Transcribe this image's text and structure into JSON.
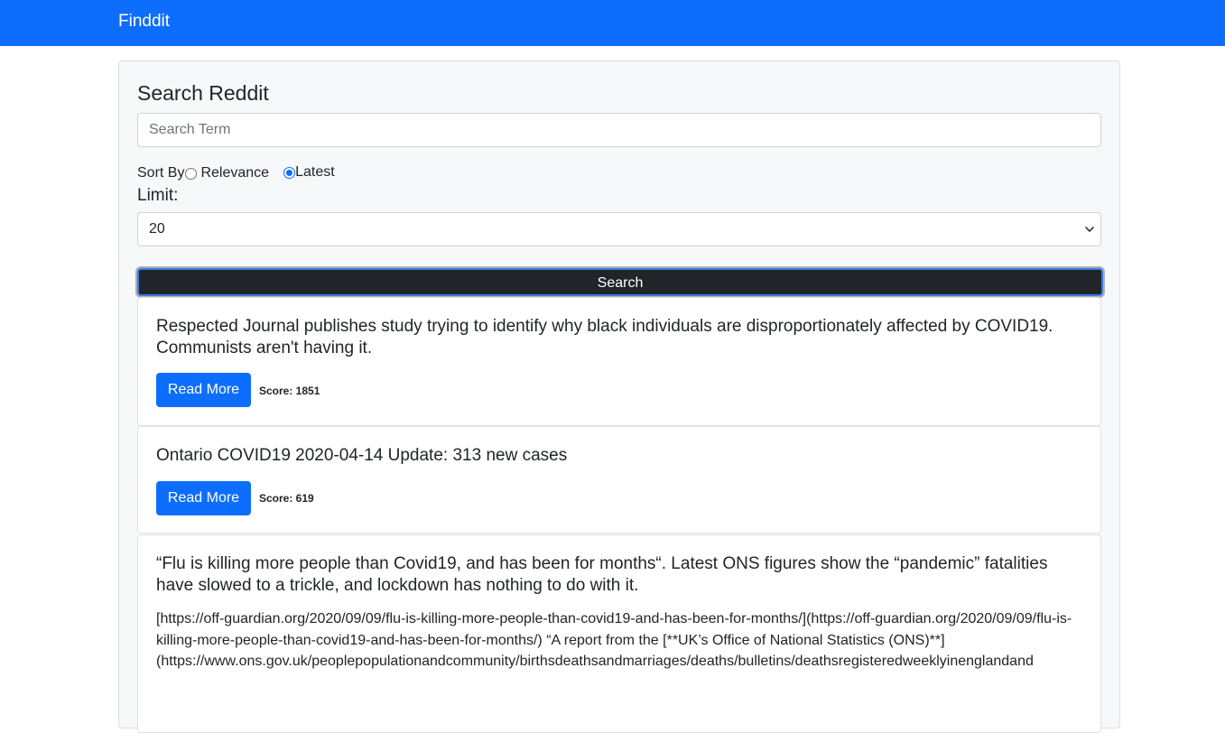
{
  "navbar": {
    "brand": "Finddit"
  },
  "search": {
    "title": "Search Reddit",
    "placeholder": "Search Term",
    "sort_label": "Sort By",
    "sort_options": [
      {
        "label": "Relevance",
        "checked": false
      },
      {
        "label": "Latest",
        "checked": true
      }
    ],
    "limit_label": "Limit:",
    "limit_value": "20",
    "button_label": "Search"
  },
  "results": [
    {
      "title": "Respected Journal publishes study trying to identify why black individuals are disproportionately affected by COVID19. Communists aren't having it.",
      "button": "Read More",
      "score": "Score: 1851"
    },
    {
      "title": "Ontario COVID19 2020-04-14 Update: 313 new cases",
      "button": "Read More",
      "score": "Score: 619"
    },
    {
      "title": "“Flu is killing more people than Covid19, and has been for months“. Latest ONS figures show the “pandemic” fatalities have slowed to a trickle, and lockdown has nothing to do with it.",
      "text": "[https://off-guardian.org/2020/09/09/flu-is-killing-more-people-than-covid19-and-has-been-for-months/](https://off-guardian.org/2020/09/09/flu-is-killing-more-people-than-covid19-and-has-been-for-months/) “A report from the [**UK’s Office of National Statistics (ONS)**](https://www.ons.gov.uk/peoplepopulationandcommunity/birthsdeathsandmarriages/deaths/bulletins/deathsregisteredweeklyinenglandand"
    }
  ]
}
